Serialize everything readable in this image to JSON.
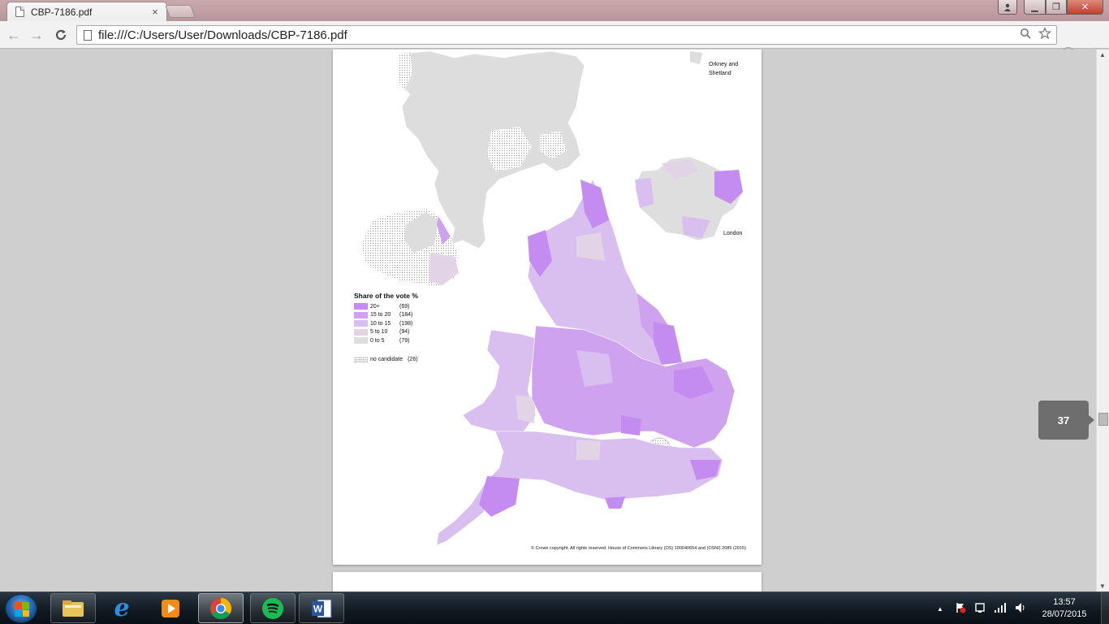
{
  "browser": {
    "tab_title": "CBP-7186.pdf",
    "tab_close": "×",
    "window_buttons": {
      "minimize": "▁",
      "maximize": "❐",
      "close": "✕",
      "user": "👤"
    },
    "nav": {
      "back": "←",
      "forward": "→",
      "reload": "C"
    },
    "url": "file:///C:/Users/User/Downloads/CBP-7186.pdf",
    "icons": [
      "search-icon",
      "star-icon",
      "extension-icon",
      "menu-icon"
    ]
  },
  "viewer": {
    "current_page": "37",
    "map": {
      "inset_label_orkney": "Orkney and\nShetland",
      "inset_label_london": "London",
      "legend_title": "Share of the vote %",
      "legend": [
        {
          "range": "20+",
          "count": "(69)",
          "color": "#c48cf0"
        },
        {
          "range": "15  to  20",
          "count": "(184)",
          "color": "#cfa2f0"
        },
        {
          "range": "10  to  15",
          "count": "(198)",
          "color": "#d8bff0"
        },
        {
          "range": "5  to  10",
          "count": "(94)",
          "color": "#e2d4e6"
        },
        {
          "range": "0  to   5",
          "count": "(79)",
          "color": "#dedede"
        }
      ],
      "no_candidate": "no candidate",
      "no_candidate_count": "(26)",
      "copyright": "© Crown copyright. All rights reserved. House of Commons Library (OS) 100040654 and (OSNI) 2085 (2015)"
    }
  },
  "taskbar": {
    "apps": [
      "file-explorer",
      "internet-explorer",
      "media-player",
      "chrome",
      "spotify",
      "word"
    ],
    "tray_expand": "▲",
    "time": "13:57",
    "date": "28/07/2015"
  }
}
